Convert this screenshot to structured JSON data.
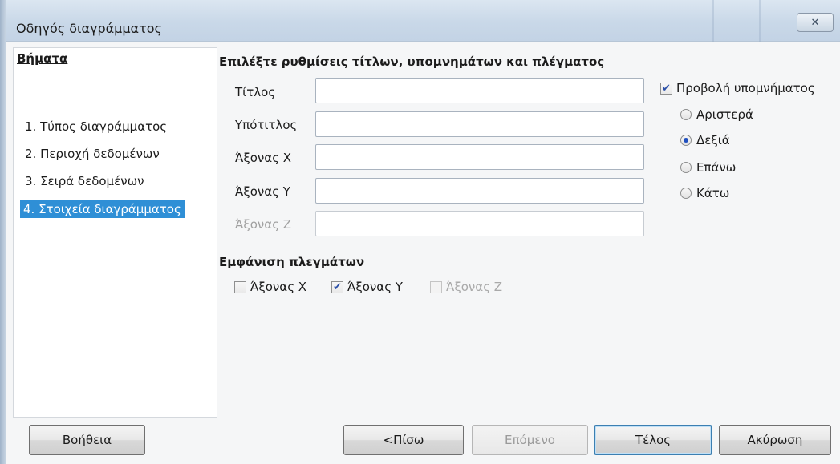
{
  "window": {
    "title": "Οδηγός διαγράμματος",
    "close_glyph": "✕"
  },
  "steps": {
    "title": "Βήματα",
    "items": [
      {
        "label": "1. Τύπος διαγράμματος",
        "active": false
      },
      {
        "label": "2. Περιοχή δεδομένων",
        "active": false
      },
      {
        "label": "3. Σειρά δεδομένων",
        "active": false
      },
      {
        "label": "4. Στοιχεία διαγράμματος",
        "active": true
      }
    ]
  },
  "main": {
    "section_title": "Επιλέξτε ρυθμίσεις τίτλων, υπομνημάτων και πλέγματος",
    "fields": [
      {
        "label": "Τίτλος",
        "value": "",
        "enabled": true
      },
      {
        "label": "Υπότιτλος",
        "value": "",
        "enabled": true
      },
      {
        "label": "Άξονας X",
        "value": "",
        "enabled": true
      },
      {
        "label": "Άξονας Y",
        "value": "",
        "enabled": true
      },
      {
        "label": "Άξονας Z",
        "value": "",
        "enabled": false
      }
    ],
    "legend": {
      "show_label": "Προβολή υπομνήματος",
      "checked": true,
      "options": [
        {
          "label": "Αριστερά",
          "selected": false
        },
        {
          "label": "Δεξιά",
          "selected": true
        },
        {
          "label": "Επάνω",
          "selected": false
        },
        {
          "label": "Κάτω",
          "selected": false
        }
      ]
    },
    "grid": {
      "title": "Εμφάνιση πλεγμάτων",
      "options": [
        {
          "label": "Άξονας X",
          "checked": false,
          "enabled": true
        },
        {
          "label": "Άξονας Y",
          "checked": true,
          "enabled": true
        },
        {
          "label": "Άξονας Z",
          "checked": false,
          "enabled": false
        }
      ]
    }
  },
  "buttons": {
    "help": "Βοήθεια",
    "back": "<Πίσω",
    "next": "Επόμενο",
    "finish": "Τέλος",
    "cancel": "Ακύρωση"
  },
  "colors": {
    "selection": "#2f8fd6",
    "titlebar": "#c9d8e8"
  }
}
